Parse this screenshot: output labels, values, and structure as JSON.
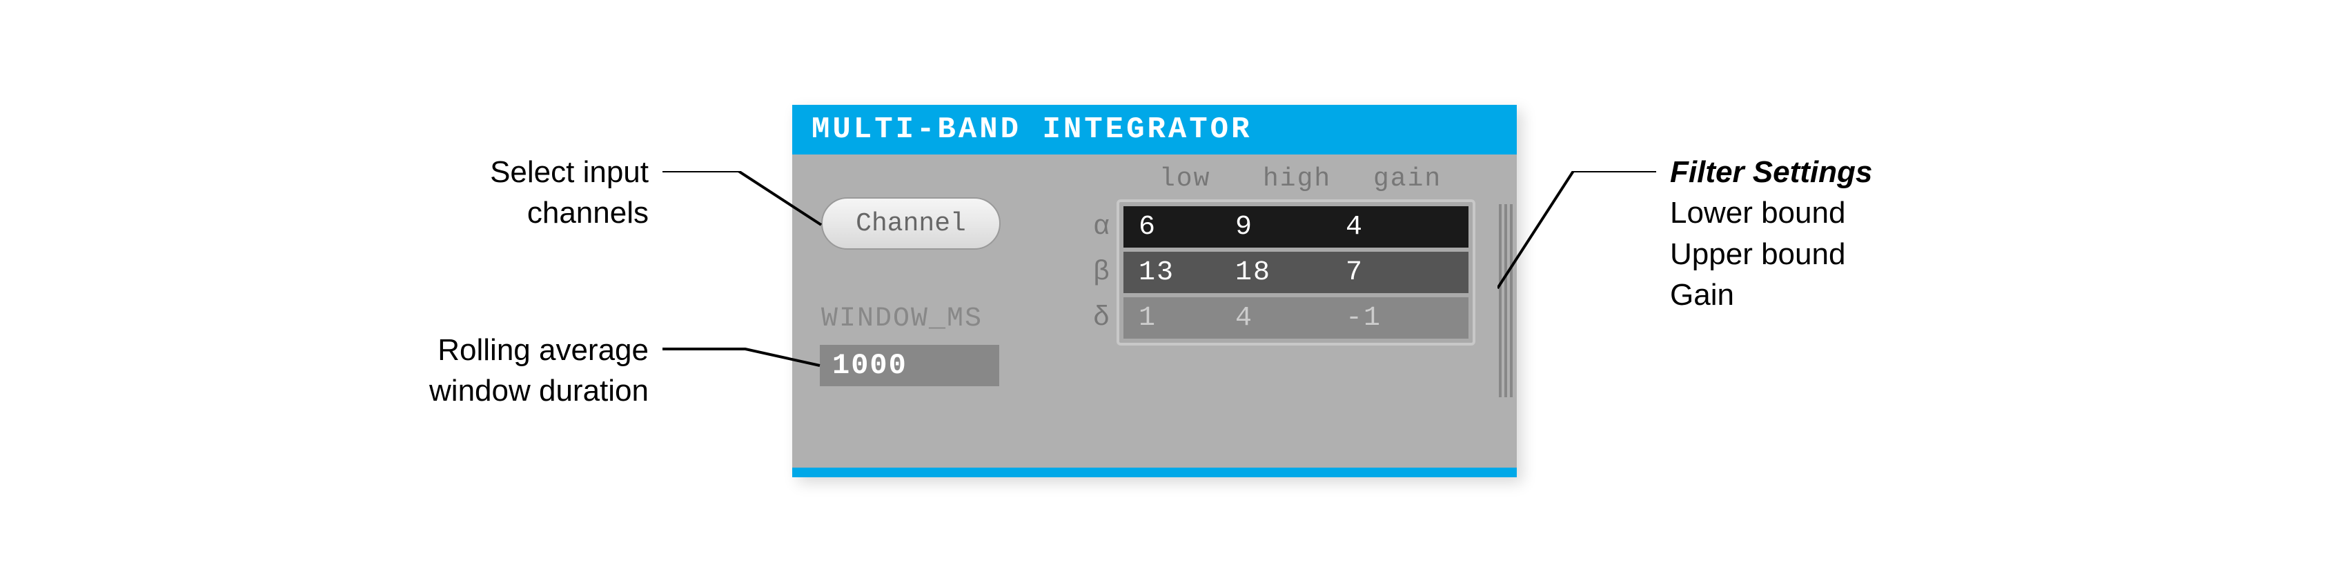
{
  "panel": {
    "title": "MULTI-BAND INTEGRATOR"
  },
  "channel": {
    "button_label": "Channel"
  },
  "window": {
    "label": "WINDOW_MS",
    "value": "1000"
  },
  "filter": {
    "headers": {
      "low": "low",
      "high": "high",
      "gain": "gain"
    },
    "bands": [
      {
        "symbol": "α",
        "low": "6",
        "high": "9",
        "gain": "4"
      },
      {
        "symbol": "β",
        "low": "13",
        "high": "18",
        "gain": "7"
      },
      {
        "symbol": "δ",
        "low": "1",
        "high": "4",
        "gain": "-1"
      }
    ]
  },
  "callouts": {
    "channel": {
      "line1": "Select input",
      "line2": "channels"
    },
    "window": {
      "line1": "Rolling average",
      "line2": "window duration"
    },
    "filter": {
      "title": "Filter Settings",
      "line1": "Lower bound",
      "line2": "Upper bound",
      "line3": "Gain"
    }
  }
}
